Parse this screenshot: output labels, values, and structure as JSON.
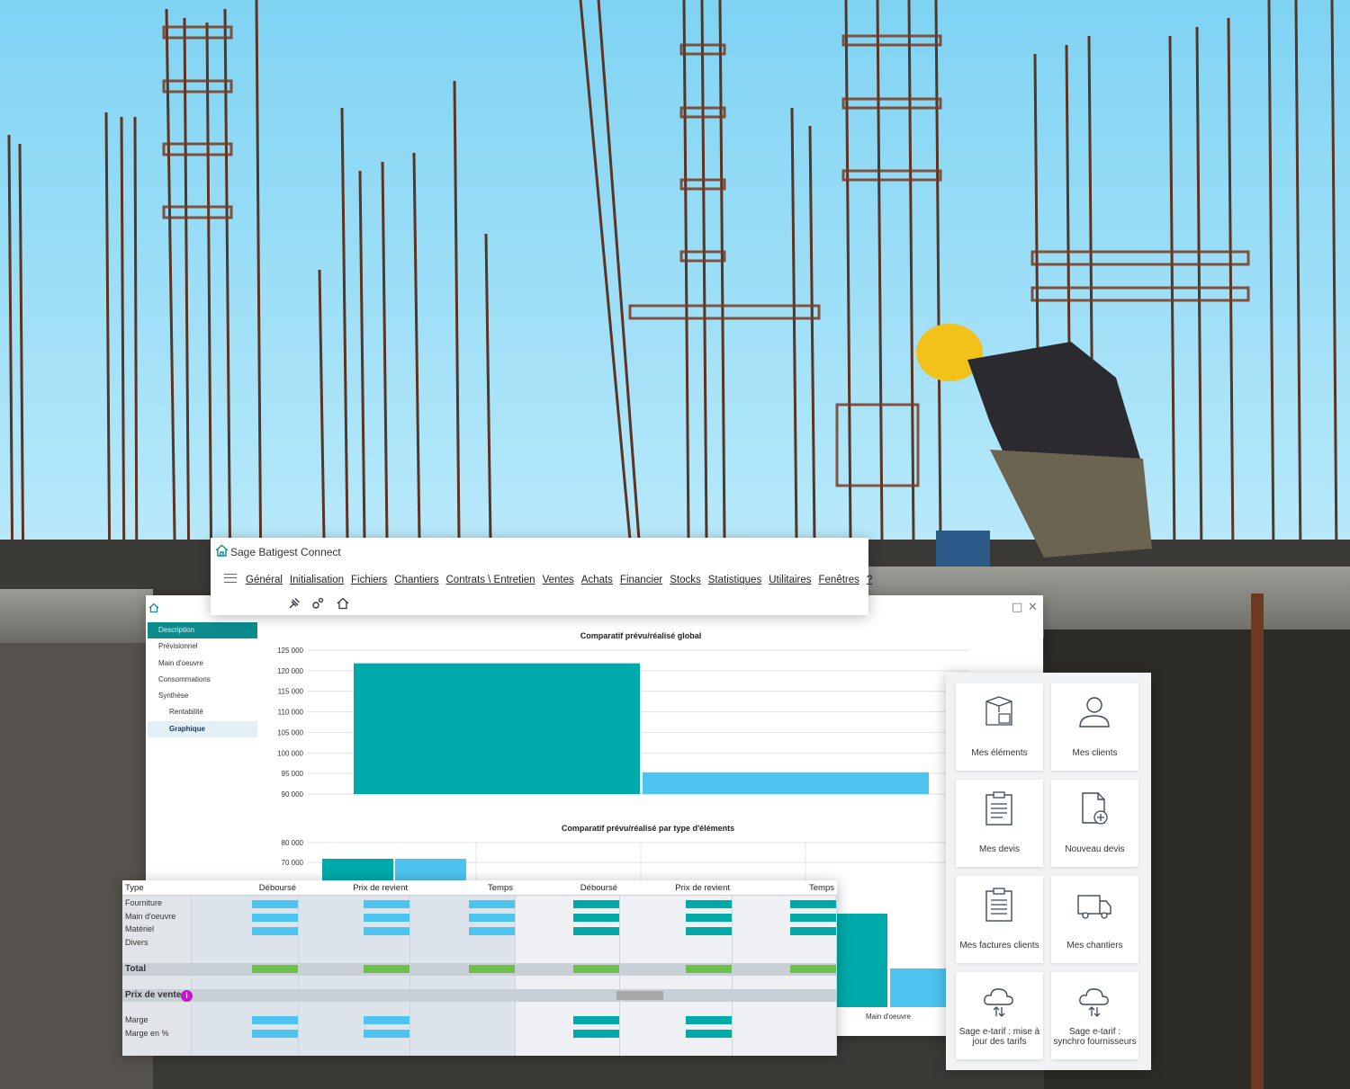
{
  "colors": {
    "teal": "#00a9aa",
    "light_blue": "#4cc4ef",
    "green": "#6cc04a",
    "grey": "#a8a8a8",
    "nav_active": "#0c8c8d"
  },
  "app": {
    "title": "Sage Batigest Connect",
    "menu": [
      "Général",
      "Initialisation",
      "Fichiers",
      "Chantiers",
      "Contrats \\ Entretien",
      "Ventes",
      "Achats",
      "Financier",
      "Stocks",
      "Statistiques",
      "Utilitaires",
      "Fenêtres",
      "?"
    ],
    "toolbar_icons": [
      "pin-icon",
      "settings-icon",
      "home-icon"
    ]
  },
  "side_nav": {
    "items": [
      {
        "label": "Description",
        "level": 0,
        "state": "active"
      },
      {
        "label": "Prévisionnel",
        "level": 0,
        "state": ""
      },
      {
        "label": "Main d'oeuvre",
        "level": 0,
        "state": ""
      },
      {
        "label": "Consommations",
        "level": 0,
        "state": ""
      },
      {
        "label": "Synthèse",
        "level": 0,
        "state": ""
      },
      {
        "label": "Rentabilité",
        "level": 1,
        "state": ""
      },
      {
        "label": "Graphique",
        "level": 1,
        "state": "selected"
      }
    ]
  },
  "chart_data": [
    {
      "type": "bar",
      "title": "Comparatif prévu/réalisé global",
      "categories": [
        ""
      ],
      "series": [
        {
          "values": [
            121800
          ],
          "color": "#00a9aa"
        },
        {
          "values": [
            95300
          ],
          "color": "#4cc4ef"
        }
      ],
      "yticks": [
        "90 000",
        "95 000",
        "100 000",
        "105 000",
        "110 000",
        "115 000",
        "120 000",
        "125 000"
      ],
      "ylim": [
        90000,
        125000
      ],
      "grid": true
    },
    {
      "type": "bar",
      "title": "Comparatif prévu/réalisé par type d'éléments",
      "categories": [
        "",
        "",
        "",
        "Main d'oeuvre"
      ],
      "series": [
        {
          "values": [
            72800,
            null,
            null,
            45000
          ],
          "color": "#00a9aa"
        },
        {
          "values": [
            72800,
            null,
            null,
            31000
          ],
          "color": "#4cc4ef"
        }
      ],
      "yticks": [
        "70 000",
        "80 000"
      ],
      "grid": true
    }
  ],
  "grid": {
    "headers": [
      "Type",
      "Déboursé",
      "Prix de revient",
      "Temps",
      "Déboursé",
      "Prix de revient",
      "Temps"
    ],
    "rows": [
      "Fourniture",
      "Main d'oeuvre",
      "Matériel",
      "Divers"
    ],
    "total_label": "Total",
    "prix_vente_label": "Prix de vente",
    "info_badge": "i",
    "marge_rows": [
      "Marge",
      "Marge en %"
    ]
  },
  "tiles": [
    {
      "label": "Mes éléments",
      "icon": "box-document-icon"
    },
    {
      "label": "Mes clients",
      "icon": "user-icon"
    },
    {
      "label": "Mes devis",
      "icon": "clipboard-icon"
    },
    {
      "label": "Nouveau devis",
      "icon": "new-document-icon"
    },
    {
      "label": "Mes factures clients",
      "icon": "invoice-clipboard-icon"
    },
    {
      "label": "Mes chantiers",
      "icon": "truck-icon"
    },
    {
      "label": "Sage e-tarif : mise à jour des tarifs",
      "icon": "cloud-sync-icon"
    },
    {
      "label": "Sage e-tarif : synchro fournisseurs",
      "icon": "cloud-sync-icon"
    }
  ]
}
